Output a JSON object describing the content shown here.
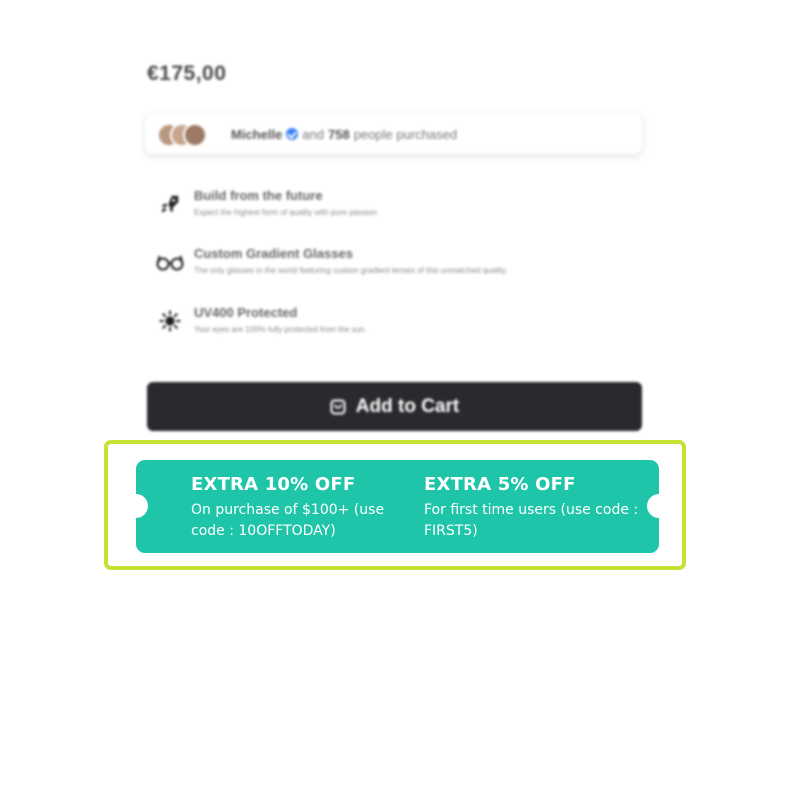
{
  "product": {
    "price": "€175,00"
  },
  "social_proof": {
    "name": "Michelle",
    "connector": "and",
    "count": "758",
    "suffix": "people purchased"
  },
  "features": [
    {
      "icon": "rocket-icon",
      "title": "Build from the future",
      "description": "Expect the highest form of quality with pure passion."
    },
    {
      "icon": "glasses-icon",
      "title": "Custom Gradient Glasses",
      "description": "The only glasses in the world featuring custom gradient lenses of this unmatched quality."
    },
    {
      "icon": "sun-icon",
      "title": "UV400 Protected",
      "description": "Your eyes are 100% fully protected from the sun."
    }
  ],
  "cart": {
    "label": "Add to Cart",
    "icon": "shopping-bag-icon"
  },
  "coupon": {
    "offers": [
      {
        "title": "EXTRA 10% OFF",
        "description": "On purchase of $100+ (use code : 10OFFTODAY)"
      },
      {
        "title": "EXTRA 5% OFF",
        "description": "For first time users (use code : FIRST5)"
      }
    ]
  },
  "colors": {
    "coupon_bg": "#1fc5a8",
    "highlight_border": "#c9e034",
    "cart_button_bg": "#2a2a2e",
    "verified": "#3b82f6"
  }
}
